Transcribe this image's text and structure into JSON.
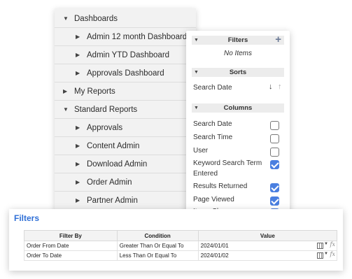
{
  "tree": {
    "items": [
      {
        "label": "Dashboards",
        "expanded": true,
        "level": 0
      },
      {
        "label": "Admin 12 month Dashboard",
        "expanded": false,
        "level": 1
      },
      {
        "label": "Admin YTD Dashboard",
        "expanded": false,
        "level": 1
      },
      {
        "label": "Approvals Dashboard",
        "expanded": false,
        "level": 1
      },
      {
        "label": "My Reports",
        "expanded": false,
        "level": 0
      },
      {
        "label": "Standard Reports",
        "expanded": true,
        "level": 0
      },
      {
        "label": "Approvals",
        "expanded": false,
        "level": 1
      },
      {
        "label": "Content Admin",
        "expanded": false,
        "level": 1
      },
      {
        "label": "Download Admin",
        "expanded": false,
        "level": 1
      },
      {
        "label": "Order Admin",
        "expanded": false,
        "level": 1
      },
      {
        "label": "Partner Admin",
        "expanded": false,
        "level": 1
      }
    ]
  },
  "side_panel": {
    "filters_header": "Filters",
    "add_icon": "plus-icon",
    "no_items": "No Items",
    "sorts_header": "Sorts",
    "sort_field": "Search Date",
    "columns_header": "Columns",
    "columns": [
      {
        "label": "Search Date",
        "checked": false
      },
      {
        "label": "Search Time",
        "checked": false
      },
      {
        "label": "User",
        "checked": false
      },
      {
        "label": "Keyword Search Term Entered",
        "checked": true
      },
      {
        "label": "Results Returned",
        "checked": true
      },
      {
        "label": "Page Viewed",
        "checked": true
      },
      {
        "label": "Items Shown",
        "checked": true
      }
    ]
  },
  "filters_panel": {
    "title": "Filters",
    "headers": [
      "Filter By",
      "Condition",
      "Value"
    ],
    "rows": [
      {
        "filter_by": "Order From Date",
        "condition": "Greater Than Or Equal To",
        "value": "2024/01/01"
      },
      {
        "filter_by": "Order To Date",
        "condition": "Less Than Or Equal To",
        "value": "2024/01/02"
      }
    ]
  },
  "colors": {
    "accent": "#2f6fd6",
    "checkbox": "#4a7fe0",
    "plus": "#6b7a96"
  }
}
